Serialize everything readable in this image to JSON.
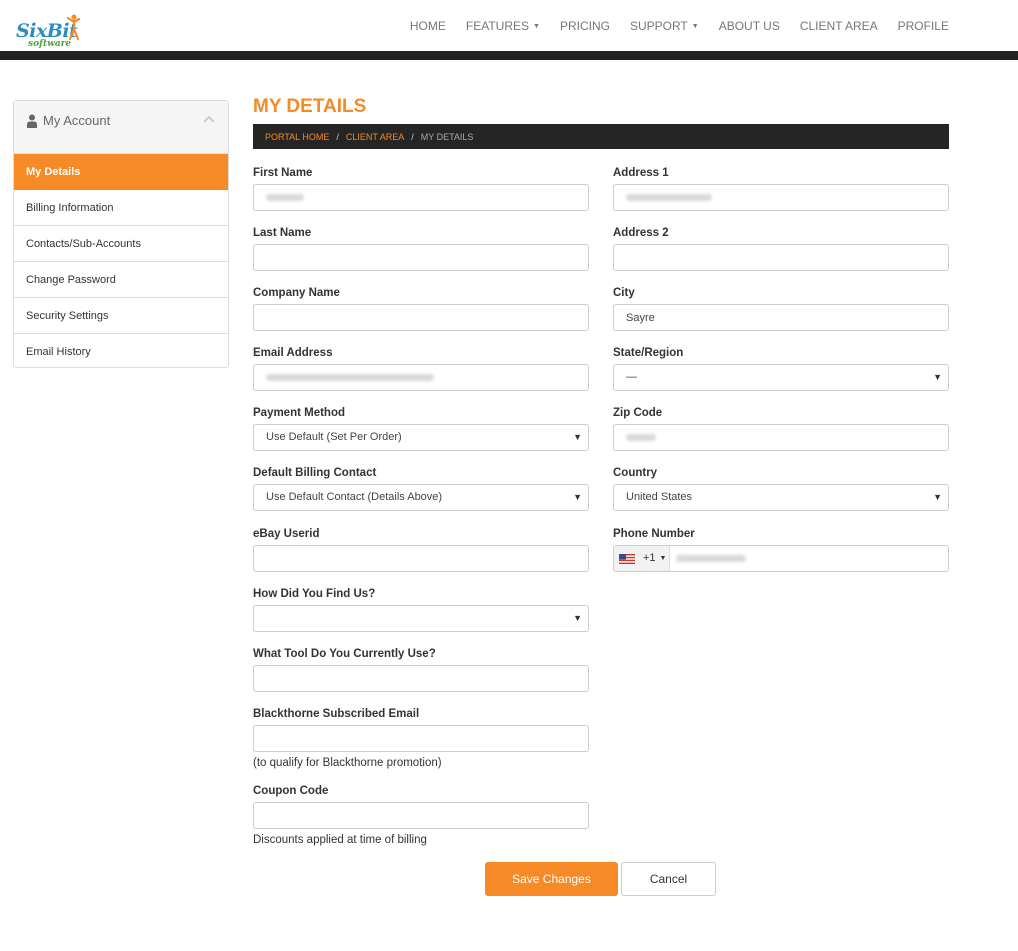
{
  "logo": {
    "brand": "SixBit",
    "sub": "software"
  },
  "nav": [
    {
      "label": "HOME",
      "dropdown": false
    },
    {
      "label": "FEATURES",
      "dropdown": true
    },
    {
      "label": "PRICING",
      "dropdown": false
    },
    {
      "label": "SUPPORT",
      "dropdown": true
    },
    {
      "label": "ABOUT US",
      "dropdown": false
    },
    {
      "label": "CLIENT AREA",
      "dropdown": false
    },
    {
      "label": "PROFILE",
      "dropdown": false
    }
  ],
  "sidebar": {
    "title": "My Account",
    "items": [
      {
        "label": "My Details",
        "active": true
      },
      {
        "label": "Billing Information",
        "active": false
      },
      {
        "label": "Contacts/Sub-Accounts",
        "active": false
      },
      {
        "label": "Change Password",
        "active": false
      },
      {
        "label": "Security Settings",
        "active": false
      },
      {
        "label": "Email History",
        "active": false
      }
    ]
  },
  "page": {
    "title": "MY DETAILS",
    "breadcrumb": {
      "home": "PORTAL HOME",
      "client": "CLIENT AREA",
      "current": "MY DETAILS"
    }
  },
  "form": {
    "first_name": {
      "label": "First Name",
      "value": ""
    },
    "last_name": {
      "label": "Last Name",
      "value": ""
    },
    "company_name": {
      "label": "Company Name",
      "value": ""
    },
    "email": {
      "label": "Email Address",
      "value": ""
    },
    "payment_method": {
      "label": "Payment Method",
      "value": "Use Default (Set Per Order)"
    },
    "billing_contact": {
      "label": "Default Billing Contact",
      "value": "Use Default Contact (Details Above)"
    },
    "ebay_userid": {
      "label": "eBay Userid",
      "value": ""
    },
    "find_us": {
      "label": "How Did You Find Us?",
      "value": ""
    },
    "tool": {
      "label": "What Tool Do You Currently Use?",
      "value": ""
    },
    "blackthorne": {
      "label": "Blackthorne Subscribed Email",
      "value": "",
      "help": "(to qualify for Blackthorne promotion)"
    },
    "coupon": {
      "label": "Coupon Code",
      "value": "",
      "help": "Discounts applied at time of billing"
    },
    "address1": {
      "label": "Address 1",
      "value": ""
    },
    "address2": {
      "label": "Address 2",
      "value": ""
    },
    "city": {
      "label": "City",
      "value": "Sayre"
    },
    "state": {
      "label": "State/Region",
      "value": "—"
    },
    "zip": {
      "label": "Zip Code",
      "value": ""
    },
    "country": {
      "label": "Country",
      "value": "United States"
    },
    "phone": {
      "label": "Phone Number",
      "code": "+1",
      "value": ""
    }
  },
  "buttons": {
    "save": "Save Changes",
    "cancel": "Cancel"
  },
  "colors": {
    "accent": "#f58a27",
    "dark": "#252525"
  }
}
